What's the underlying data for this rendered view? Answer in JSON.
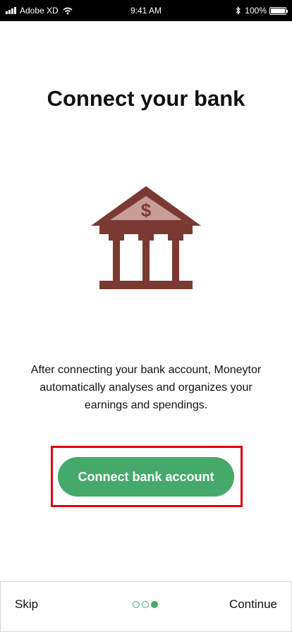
{
  "status_bar": {
    "carrier": "Adobe XD",
    "time": "9:41 AM",
    "battery": "100%",
    "icons": [
      "signal-icon",
      "wifi-icon",
      "bluetooth-icon",
      "battery-icon"
    ]
  },
  "title": "Connect your bank",
  "illustration": {
    "icon": "bank-icon",
    "symbol": "$",
    "colors": {
      "building": "#7a3a33",
      "roof_inner": "#c99d95"
    }
  },
  "description": "After connecting your bank account, Moneytor automatically analyses and organizes your earnings and spendings.",
  "connect_button": {
    "label": "Connect bank account",
    "color": "#45a96b"
  },
  "bottom_bar": {
    "skip_label": "Skip",
    "continue_label": "Continue",
    "page_indicator": {
      "total": 3,
      "active_index": 2
    }
  },
  "highlight_color": "#e00010"
}
